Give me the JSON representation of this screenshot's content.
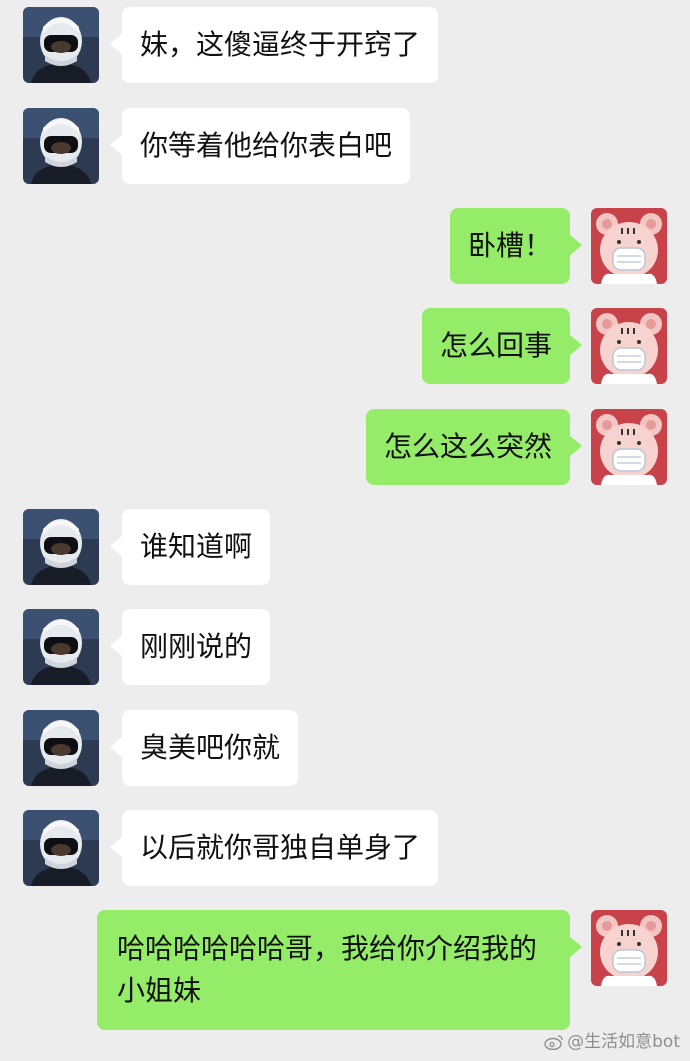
{
  "messages": [
    {
      "side": "left",
      "text": "妹，这傻逼终于开窍了"
    },
    {
      "side": "left",
      "text": "你等着他给你表白吧"
    },
    {
      "side": "right",
      "text": "卧槽！"
    },
    {
      "side": "right",
      "text": "怎么回事"
    },
    {
      "side": "right",
      "text": "怎么这么突然"
    },
    {
      "side": "left",
      "text": "谁知道啊"
    },
    {
      "side": "left",
      "text": "刚刚说的"
    },
    {
      "side": "left",
      "text": "臭美吧你就"
    },
    {
      "side": "left",
      "text": "以后就你哥独自单身了"
    },
    {
      "side": "right",
      "text": "哈哈哈哈哈哈哥，我给你介绍我的小姐妹"
    }
  ],
  "avatars": {
    "left": "helmet-rider-avatar",
    "right": "pink-bear-masked-avatar"
  },
  "watermark": "@生活如意bot",
  "colors": {
    "background": "#ededed",
    "incoming_bubble": "#ffffff",
    "outgoing_bubble": "#95ec69"
  }
}
